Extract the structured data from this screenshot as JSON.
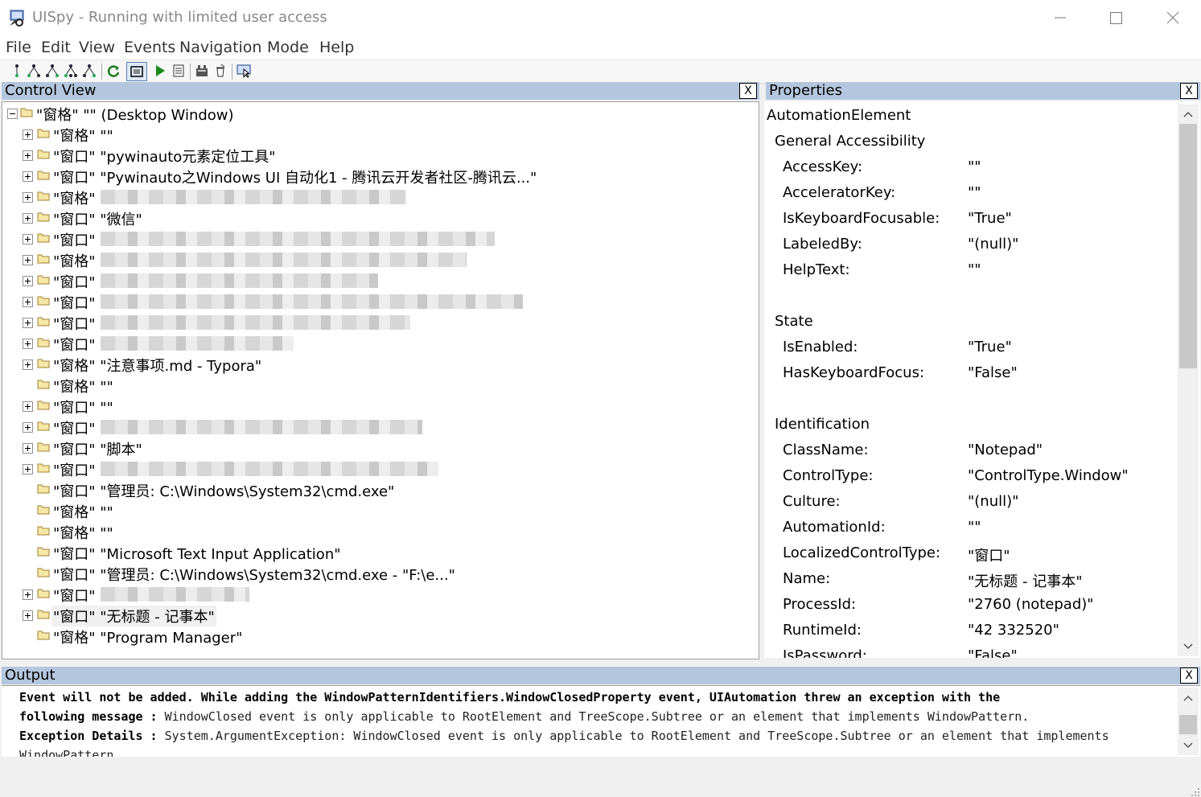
{
  "window": {
    "title": "UISpy - Running with limited user access",
    "minimize_icon": "minimize-icon",
    "maximize_icon": "maximize-icon",
    "close_icon": "close-icon"
  },
  "menu": [
    "File",
    "Edit",
    "View",
    "Events",
    "Navigation",
    "Mode",
    "Help"
  ],
  "control_view": {
    "title": "Control View",
    "close_label": "X",
    "root_label": "\"窗格\" \"\" (Desktop Window)",
    "items": [
      {
        "label": "\"窗格\" \"\"",
        "expandable": true
      },
      {
        "label": "\"窗口\" \"pywinauto元素定位工具\"",
        "expandable": true
      },
      {
        "label": "\"窗口\" \"Pywinauto之Windows UI 自动化1 - 腾讯云开发者社区-腾讯云...\"",
        "expandable": true
      },
      {
        "label": "\"窗格\"",
        "expandable": true,
        "redacted": true
      },
      {
        "label": "\"窗口\" \"微信\"",
        "expandable": true
      },
      {
        "label": "\"窗口\"",
        "expandable": true,
        "redacted": true
      },
      {
        "label": "\"窗格\"",
        "expandable": true,
        "redacted": true
      },
      {
        "label": "\"窗口\"",
        "expandable": true,
        "redacted": true
      },
      {
        "label": "\"窗口\"",
        "expandable": true,
        "redacted": true
      },
      {
        "label": "\"窗口\"",
        "expandable": true,
        "redacted": true
      },
      {
        "label": "\"窗口\"",
        "expandable": true,
        "redacted": true
      },
      {
        "label": "\"窗格\" \"注意事项.md - Typora\"",
        "expandable": true
      },
      {
        "label": "\"窗格\" \"\"",
        "expandable": false
      },
      {
        "label": "\"窗口\" \"\"",
        "expandable": true
      },
      {
        "label": "\"窗口\"",
        "expandable": true,
        "redacted": true
      },
      {
        "label": "\"窗口\" \"脚本\"",
        "expandable": true
      },
      {
        "label": "\"窗口\"",
        "expandable": true,
        "redacted": true
      },
      {
        "label": "\"窗口\" \"管理员: C:\\Windows\\System32\\cmd.exe\"",
        "expandable": false
      },
      {
        "label": "\"窗格\" \"\"",
        "expandable": false
      },
      {
        "label": "\"窗格\" \"\"",
        "expandable": false
      },
      {
        "label": "\"窗口\" \"Microsoft Text Input Application\"",
        "expandable": false
      },
      {
        "label": "\"窗口\" \"管理员: C:\\Windows\\System32\\cmd.exe - \"F:\\e...\"",
        "expandable": false
      },
      {
        "label": "\"窗口\"",
        "expandable": true,
        "redacted": true
      },
      {
        "label": "\"窗口\" \"无标题 - 记事本\"",
        "expandable": true,
        "selected": true
      },
      {
        "label": "\"窗格\" \"Program Manager\"",
        "expandable": false
      }
    ]
  },
  "properties": {
    "title": "Properties",
    "close_label": "X",
    "root": "AutomationElement",
    "groups": [
      {
        "name": "General Accessibility",
        "props": [
          {
            "k": "AccessKey:",
            "v": "\"\""
          },
          {
            "k": "AcceleratorKey:",
            "v": "\"\""
          },
          {
            "k": "IsKeyboardFocusable:",
            "v": "\"True\""
          },
          {
            "k": "LabeledBy:",
            "v": "\"(null)\""
          },
          {
            "k": "HelpText:",
            "v": "\"\""
          }
        ]
      },
      {
        "name": "State",
        "props": [
          {
            "k": "IsEnabled:",
            "v": "\"True\""
          },
          {
            "k": "HasKeyboardFocus:",
            "v": "\"False\""
          }
        ]
      },
      {
        "name": "Identification",
        "props": [
          {
            "k": "ClassName:",
            "v": "\"Notepad\""
          },
          {
            "k": "ControlType:",
            "v": "\"ControlType.Window\""
          },
          {
            "k": "Culture:",
            "v": "\"(null)\""
          },
          {
            "k": "AutomationId:",
            "v": "\"\""
          },
          {
            "k": "LocalizedControlType:",
            "v": "\"窗口\""
          },
          {
            "k": "Name:",
            "v": "\"无标题 - 记事本\""
          },
          {
            "k": "ProcessId:",
            "v": "\"2760 (notepad)\""
          },
          {
            "k": "RuntimeId:",
            "v": "\"42 332520\""
          },
          {
            "k": "IsPassword:",
            "v": "\"False\""
          }
        ]
      }
    ]
  },
  "output": {
    "title": "Output",
    "close_label": "X",
    "lines": [
      {
        "bold": "Event will not be added.  While adding the WindowPatternIdentifiers.WindowClosedProperty event, UIAutomation threw an exception with the",
        "text": ""
      },
      {
        "bold": "following message :",
        "text": " WindowClosed event is only applicable to RootElement and TreeScope.Subtree or an element that implements WindowPattern."
      },
      {
        "bold": "Exception Details :",
        "text": " System.ArgumentException: WindowClosed event is only applicable to RootElement and TreeScope.Subtree or an element that implements"
      },
      {
        "bold": "",
        "text": "WindowPattern."
      }
    ]
  },
  "toolbar_icons": [
    "parent-icon",
    "first-child-icon",
    "next-sibling-icon",
    "previous-sibling-icon",
    "last-child-icon",
    "refresh-icon",
    "highlight-rectangle-icon",
    "run-icon",
    "properties-icon",
    "record-icon",
    "clear-icon",
    "focus-tracking-icon"
  ]
}
